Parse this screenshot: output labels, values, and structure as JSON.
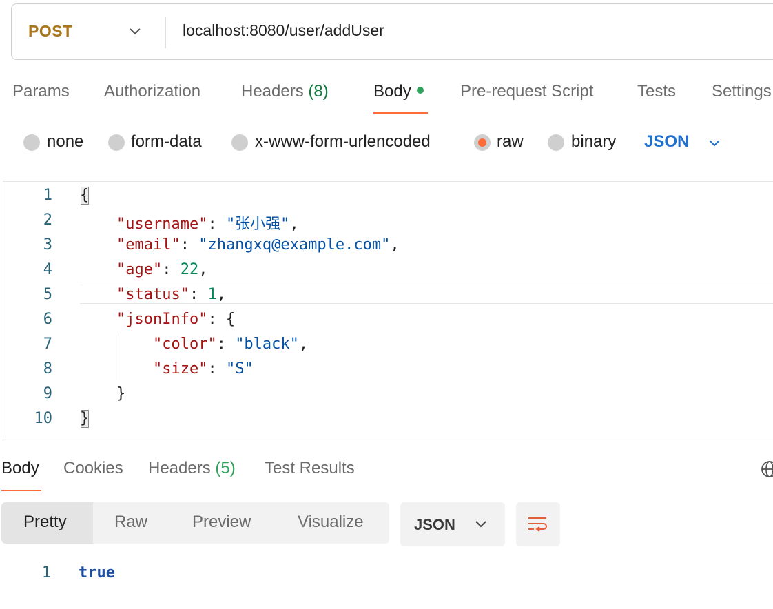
{
  "request": {
    "method": "POST",
    "url": "localhost:8080/user/addUser"
  },
  "request_tabs": [
    {
      "label": "Params"
    },
    {
      "label": "Authorization"
    },
    {
      "label": "Headers",
      "count": "(8)"
    },
    {
      "label": "Body",
      "active": true
    },
    {
      "label": "Pre-request Script"
    },
    {
      "label": "Tests"
    },
    {
      "label": "Settings"
    }
  ],
  "body_types": [
    {
      "label": "none"
    },
    {
      "label": "form-data"
    },
    {
      "label": "x-www-form-urlencoded"
    },
    {
      "label": "raw",
      "selected": true
    },
    {
      "label": "binary"
    }
  ],
  "body_language": "JSON",
  "editor": {
    "line_numbers": [
      "1",
      "2",
      "3",
      "4",
      "5",
      "6",
      "7",
      "8",
      "9",
      "10"
    ],
    "lines": [
      "{",
      "    \"username\": \"张小强\",",
      "    \"email\": \"zhangxq@example.com\",",
      "    \"age\": 22,",
      "    \"status\": 1,",
      "    \"jsonInfo\": {",
      "        \"color\": \"black\",",
      "        \"size\": \"S\"",
      "    }",
      "}"
    ]
  },
  "response_tabs": [
    {
      "label": "Body",
      "active": true
    },
    {
      "label": "Cookies"
    },
    {
      "label": "Headers",
      "count": "(5)"
    },
    {
      "label": "Test Results"
    }
  ],
  "response_views": [
    "Pretty",
    "Raw",
    "Preview",
    "Visualize"
  ],
  "response_format": "JSON",
  "response": {
    "line_number": "1",
    "value": "true"
  },
  "colors": {
    "accent": "#ff6c37",
    "method": "#a8761c",
    "json_select": "#1f6fce",
    "success": "#2fa35b"
  }
}
